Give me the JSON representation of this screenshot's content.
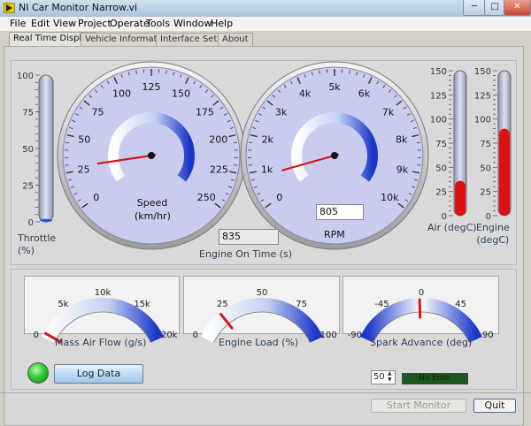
{
  "window": {
    "title": "NI Car Monitor Narrow.vi",
    "min": "─",
    "max": "□",
    "close": "✕"
  },
  "menu": [
    "File",
    "Edit",
    "View",
    "Project",
    "Operate",
    "Tools",
    "Window",
    "Help"
  ],
  "tabs": [
    "Real Time Display",
    "Vehicle Information",
    "Interface Setup",
    "About"
  ],
  "throttle": {
    "label": "Throttle\n(%)",
    "ticks": [
      "100",
      "75",
      "50",
      "25",
      "0"
    ],
    "value_fraction": 0.02
  },
  "speed": {
    "label": "Speed\n(km/hr)",
    "ticks": [
      "0",
      "25",
      "50",
      "75",
      "100",
      "125",
      "150",
      "175",
      "200",
      "225",
      "250"
    ],
    "needle_value": 28
  },
  "rpm": {
    "label": "RPM",
    "ticks": [
      "0",
      "1k",
      "2k",
      "3k",
      "4k",
      "5k",
      "6k",
      "7k",
      "8k",
      "9k",
      "10k"
    ],
    "needle_value": 835,
    "value": "805"
  },
  "engine_on_time": {
    "label": "Engine On Time (s)",
    "value": "835"
  },
  "air_temp": {
    "label": "Air (degC)",
    "ticks": [
      "150",
      "125",
      "100",
      "75",
      "50",
      "25",
      "0"
    ],
    "value_fraction": 0.24
  },
  "engine_temp": {
    "label": "Engine\n(degC)",
    "ticks": [
      "150",
      "125",
      "100",
      "75",
      "50",
      "25",
      "0"
    ],
    "value_fraction": 0.6
  },
  "mass_air_flow": {
    "label": "Mass Air Flow (g/s)",
    "ticks": [
      "0",
      "5k",
      "10k",
      "15k",
      "20k"
    ],
    "needle_value": 600
  },
  "engine_load": {
    "label": "Engine Load (%)",
    "ticks": [
      "0",
      "25",
      "50",
      "75",
      "100"
    ],
    "needle_value": 20
  },
  "spark_advance": {
    "label": "Spark Advance (deg)",
    "ticks": [
      "-90",
      "-45",
      "0",
      "45",
      "90"
    ],
    "needle_value": -2
  },
  "controls": {
    "log_data": "Log Data",
    "interval": "50",
    "status": "No Error",
    "start_monitor": "Start Monitor",
    "quit": "Quit"
  },
  "colors": {
    "led_on": "#2ecc2e",
    "gauge_face": "#c9ccef",
    "temp_fill": "#e01010",
    "throttle_fill": "#2255dd"
  }
}
